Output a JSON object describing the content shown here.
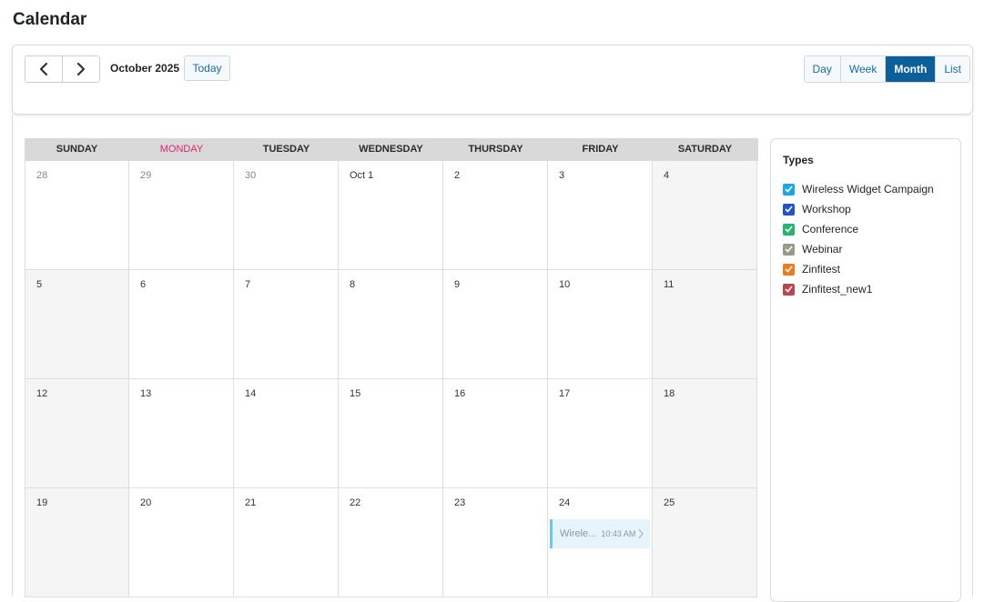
{
  "page": {
    "title": "Calendar"
  },
  "toolbar": {
    "month_label": "October 2025",
    "today_label": "Today",
    "views": [
      {
        "label": "Day",
        "active": false
      },
      {
        "label": "Week",
        "active": false
      },
      {
        "label": "Month",
        "active": true
      },
      {
        "label": "List",
        "active": false
      }
    ]
  },
  "calendar": {
    "weekdays": [
      "SUNDAY",
      "MONDAY",
      "TUESDAY",
      "WEDNESDAY",
      "THURSDAY",
      "FRIDAY",
      "SATURDAY"
    ],
    "weeks": [
      [
        "28",
        "29",
        "30",
        "Oct 1",
        "2",
        "3",
        "4"
      ],
      [
        "5",
        "6",
        "7",
        "8",
        "9",
        "10",
        "11"
      ],
      [
        "12",
        "13",
        "14",
        "15",
        "16",
        "17",
        "18"
      ],
      [
        "19",
        "20",
        "21",
        "22",
        "23",
        "24",
        "25"
      ]
    ],
    "event": {
      "title": "Wirele...",
      "time": "10:43 AM",
      "color": "#6ec6ea"
    }
  },
  "types": {
    "title": "Types",
    "items": [
      {
        "label": "Wireless Widget Campaign",
        "color": "#1ea7e8",
        "checked": true
      },
      {
        "label": "Workshop",
        "color": "#2452c9",
        "checked": true
      },
      {
        "label": "Conference",
        "color": "#25b36e",
        "checked": true
      },
      {
        "label": "Webinar",
        "color": "#9a9a88",
        "checked": true
      },
      {
        "label": "Zinfitest",
        "color": "#ee7b1f",
        "checked": true
      },
      {
        "label": "Zinfitest_new1",
        "color": "#b8464a",
        "checked": true
      }
    ]
  },
  "colors": {
    "accent": "#0d5f9a",
    "today_header": "#e0246a"
  }
}
